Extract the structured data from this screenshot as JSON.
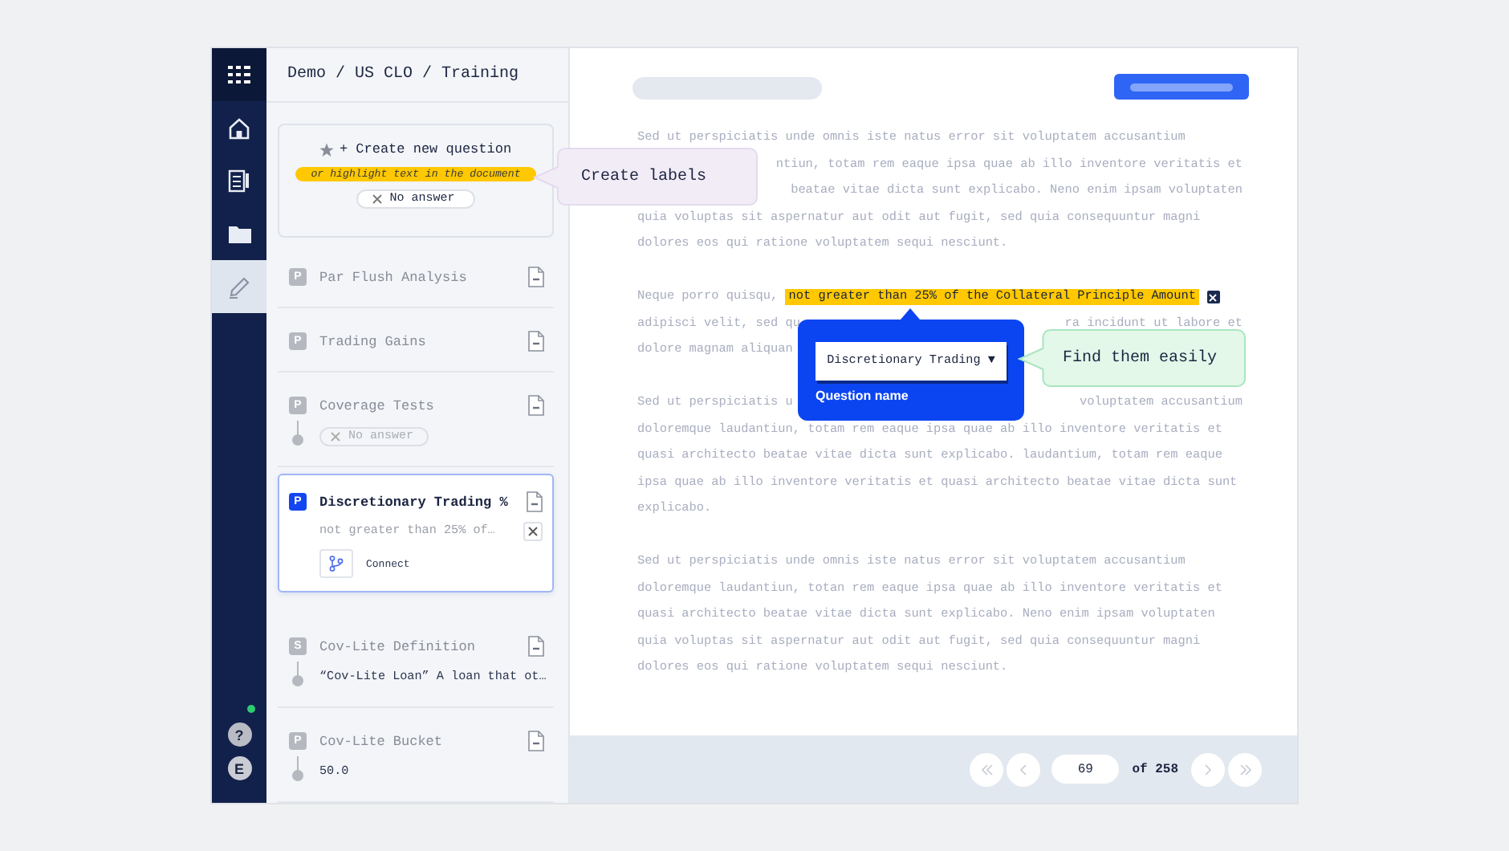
{
  "breadcrumb": "Demo / US CLO / Training",
  "nav": [
    {
      "selected": false
    },
    {
      "selected": false
    },
    {
      "selected": false
    },
    {
      "selected": true
    }
  ],
  "help": {
    "label": "?",
    "online": true
  },
  "user": {
    "initial": "E"
  },
  "create": {
    "label": "+ Create new question",
    "hint": "or highlight text in the document",
    "no_answer": "No answer"
  },
  "questions": [
    {
      "badge": "P",
      "title": "Par Flush Analysis",
      "selected": false
    },
    {
      "badge": "P",
      "title": "Trading Gains",
      "selected": false
    },
    {
      "badge": "P",
      "title": "Coverage Tests",
      "selected": false,
      "answer": {
        "kind": "empty",
        "text": "No answer"
      }
    },
    {
      "badge": "P",
      "title": "Discretionary Trading %",
      "selected": true,
      "answer": {
        "kind": "excerpt",
        "text": "not greater than 25% of…"
      },
      "action": "Connect"
    },
    {
      "badge": "S",
      "title": "Cov-Lite Definition",
      "selected": false,
      "answer": {
        "kind": "value",
        "text": "“Cov-Lite Loan” A loan that ot…"
      }
    },
    {
      "badge": "P",
      "title": "Cov-Lite Bucket",
      "selected": false,
      "answer": {
        "kind": "value",
        "text": "50.0"
      }
    }
  ],
  "document": {
    "paragraphs": [
      {
        "lines": [
          {
            "kind": "plain",
            "parts": [
              "Sed ut perspiciatis unde omnis iste natus error sit voluptatem accusantium"
            ]
          },
          {
            "kind": "tail",
            "parts": [
              "ntiun, totam rem eaque ipsa quae ab illo inventore veritatis et"
            ]
          },
          {
            "kind": "tail",
            "parts": [
              "beatae vitae dicta sunt explicabo. Neno enim ipsam voluptaten"
            ]
          },
          {
            "kind": "plain",
            "parts": [
              "quia voluptas sit aspernatur aut odit aut fugit, sed quia consequuntur magni"
            ]
          },
          {
            "kind": "plain",
            "parts": [
              "dolores eos qui ratione voluptatem sequi nesciunt."
            ]
          }
        ]
      },
      {
        "lines": [
          {
            "kind": "highlight",
            "before": "Neque porro quisqu,",
            "highlight": "not greater than 25% of the Collateral Principle Amount"
          },
          {
            "kind": "plain",
            "parts": [
              "adipisci velit, sed qu",
              "ra incidunt ut labore et"
            ]
          },
          {
            "kind": "plain",
            "parts": [
              "dolore magnam aliquan"
            ]
          }
        ]
      },
      {
        "lines": [
          {
            "kind": "plain",
            "parts": [
              "Sed ut perspiciatis u",
              "voluptatem accusantium"
            ]
          },
          {
            "kind": "plain",
            "parts": [
              "doloremque laudantiun, totam rem eaque ipsa quae ab illo inventore veritatis et"
            ]
          },
          {
            "kind": "plain",
            "parts": [
              "quasi architecto beatae vitae dicta sunt explicabo. laudantium, totam rem eaque"
            ]
          },
          {
            "kind": "plain",
            "parts": [
              "ipsa quae ab illo inventore veritatis et quasi architecto beatae vitae dicta sunt"
            ]
          },
          {
            "kind": "plain",
            "parts": [
              "explicabo."
            ]
          }
        ]
      },
      {
        "lines": [
          {
            "kind": "plain",
            "parts": [
              "Sed ut perspiciatis unde omnis iste natus error sit voluptatem accusantium"
            ]
          },
          {
            "kind": "plain",
            "parts": [
              "doloremque laudantiun, totan rem eaque ipsa quae ab illo inventore veritatis et"
            ]
          },
          {
            "kind": "plain",
            "parts": [
              "quasi architecto beatae vitae dicta sunt explicabo. Neno enim ipsam voluptaten"
            ]
          },
          {
            "kind": "plain",
            "parts": [
              "quia voluptas sit aspernatur aut odit aut fugit, sed quia consequuntur magni"
            ]
          },
          {
            "kind": "plain",
            "parts": [
              "dolores eos qui ratione voluptatem sequi nesciunt."
            ]
          }
        ]
      }
    ]
  },
  "popup": {
    "select": "Discretionary Trading ▼",
    "label": "Question name"
  },
  "callouts": [
    {
      "text": "Create labels",
      "color": "#f2ecf7"
    },
    {
      "text": "Find them easily",
      "color": "#e3f8e9"
    }
  ],
  "pagination": {
    "page": "69",
    "total": "of 258"
  }
}
